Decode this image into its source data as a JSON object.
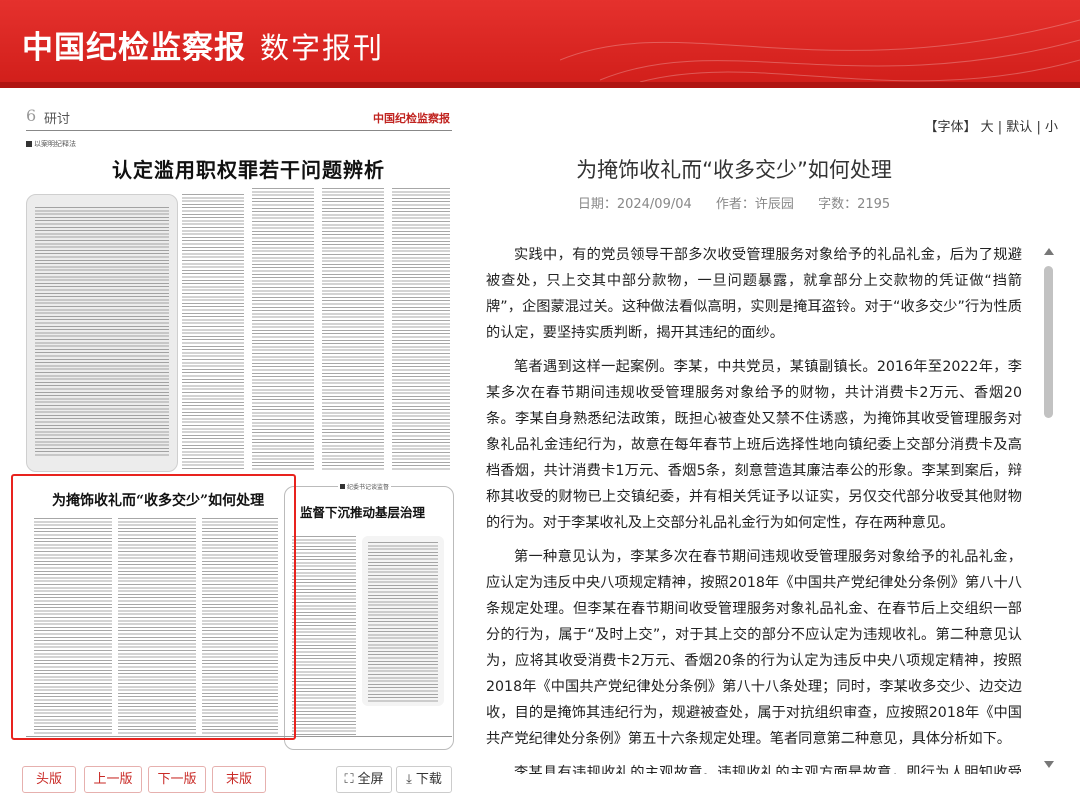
{
  "header": {
    "logo_text": "中国纪检监察报",
    "subtitle": "数字报刊",
    "brand_color": "#d82420"
  },
  "newspaper": {
    "page_number": "6",
    "section": "研讨",
    "kicker": "以案明纪释法",
    "headline_main": "认定滥用职权罪若干问题辨析",
    "headline_selected": "为掩饰收礼而“收多交少”如何处理",
    "kicker_right": "纪委书记谈监督",
    "headline_right": "监督下沉推动基层治理",
    "logo_small": "中国纪检监察报"
  },
  "pager": {
    "first": "头版",
    "prev": "上一版",
    "next": "下一版",
    "last": "末版",
    "fullscreen": "全屏",
    "download": "下载",
    "fullscreen_icon": "fullscreen-icon",
    "download_icon": "download-icon"
  },
  "font_controls": {
    "label": "【字体】",
    "large": "大",
    "default": "默认",
    "small": "小",
    "sep": "|"
  },
  "article": {
    "title": "为掩饰收礼而“收多交少”如何处理",
    "date_label": "日期：",
    "date": "2024/09/04",
    "author_label": "作者：",
    "author": "许辰园",
    "wordcount_label": "字数：",
    "wordcount": "2195",
    "paragraphs": [
      "实践中，有的党员领导干部多次收受管理服务对象给予的礼品礼金，后为了规避被查处，只上交其中部分款物，一旦问题暴露，就拿部分上交款物的凭证做“挡箭牌”，企图蒙混过关。这种做法看似高明，实则是掩耳盗铃。对于“收多交少”行为性质的认定，要坚持实质判断，揭开其违纪的面纱。",
      "笔者遇到这样一起案例。李某，中共党员，某镇副镇长。2016年至2022年，李某多次在春节期间违规收受管理服务对象给予的财物，共计消费卡2万元、香烟20条。李某自身熟悉纪法政策，既担心被查处又禁不住诱惑，为掩饰其收受管理服务对象礼品礼金违纪行为，故意在每年春节上班后选择性地向镇纪委上交部分消费卡及高档香烟，共计消费卡1万元、香烟5条，刻意营造其廉洁奉公的形象。李某到案后，辩称其收受的财物已上交镇纪委，并有相关凭证予以证实，另仅交代部分收受其他财物的行为。对于李某收礼及上交部分礼品礼金行为如何定性，存在两种意见。",
      "第一种意见认为，李某多次在春节期间违规收受管理服务对象给予的礼品礼金，应认定为违反中央八项规定精神，按照2018年《中国共产党纪律处分条例》第八十八条规定处理。但李某在春节期间收受管理服务对象礼品礼金、在春节后上交组织一部分的行为，属于“及时上交”，对于其上交的部分不应认定为违规收礼。第二种意见认为，应将其收受消费卡2万元、香烟20条的行为认定为违反中央八项规定精神，按照2018年《中国共产党纪律处分条例》第八十八条处理；同时，李某收多交少、边交边收，目的是掩饰其违纪行为，规避被查处，属于对抗组织审查，应按照2018年《中国共产党纪律处分条例》第五十六条规定处理。笔者同意第二种意见，具体分析如下。",
      "李某具有违规收礼的主观故意。违规收礼的主观方面是故意，即行为人明知收受可"
    ]
  },
  "colors": {
    "accent": "#e8231e",
    "text": "#222222",
    "meta": "#888888"
  }
}
